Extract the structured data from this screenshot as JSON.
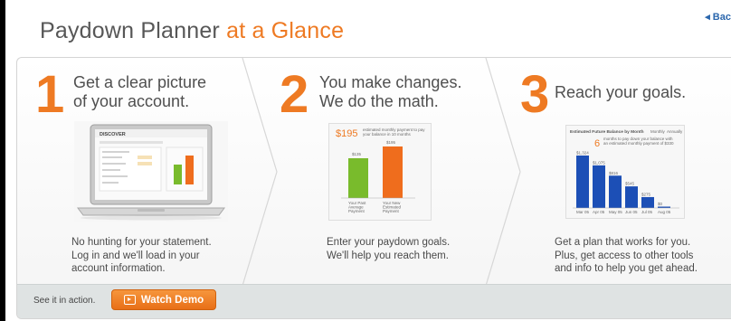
{
  "header": {
    "title_main": "Paydown Planner",
    "title_accent": "at a Glance",
    "back_link": "◂ Bac"
  },
  "steps": [
    {
      "number": "1",
      "heading_line1": "Get a clear picture",
      "heading_line2": "of your account.",
      "desc_line1": "No hunting for your statement.",
      "desc_line2": "Log in and we'll load in your",
      "desc_line3": "account information.",
      "image_icon": "laptop-icon",
      "image_logo": "DISCOVER"
    },
    {
      "number": "2",
      "heading_line1": "You make changes.",
      "heading_line2": "We do the math.",
      "desc_line1": "Enter your paydown goals.",
      "desc_line2": "We'll help you reach them.",
      "image_icon": "payment-compare-chart-icon",
      "thumb": {
        "amount": "$195",
        "caption": "estimated monthly payment to pay your balance in 10 months",
        "bar1_value": "$135",
        "bar2_value": "$195",
        "bar1_label": "Your Past Average Payment",
        "bar2_label": "Your New Estimated Payment"
      }
    },
    {
      "number": "3",
      "heading_line1": "Reach your goals.",
      "desc_line1": "Get a plan that works for you.",
      "desc_line2": "Plus, get access to other tools",
      "desc_line3": "and info to help you get ahead.",
      "image_icon": "balance-forecast-chart-icon",
      "thumb": {
        "title": "Estimated Future Balance by Month",
        "toggle1": "Monthly",
        "toggle2": "Annually",
        "months": "6",
        "caption": "months to pay down your balance with an estimated monthly payment of $330",
        "bar_values": [
          "$1,324",
          "$1,075",
          "$816",
          "$545",
          "$275",
          "$0"
        ],
        "bar_heights": [
          1324,
          1075,
          816,
          545,
          275,
          0
        ],
        "month_labels": [
          "Mar 05",
          "Apr 05",
          "May 05",
          "Jun 05",
          "Jul 05",
          "Aug 05"
        ]
      }
    }
  ],
  "footer": {
    "see_it_text": "See it in action.",
    "watch_demo_label": "Watch Demo"
  },
  "colors": {
    "accent": "#ee7a23",
    "text": "#4f4f4f",
    "link": "#2b67ad",
    "bar_blue": "#1c4fb6",
    "bar_green": "#79bb2c",
    "bar_orange": "#ef6d1d"
  }
}
